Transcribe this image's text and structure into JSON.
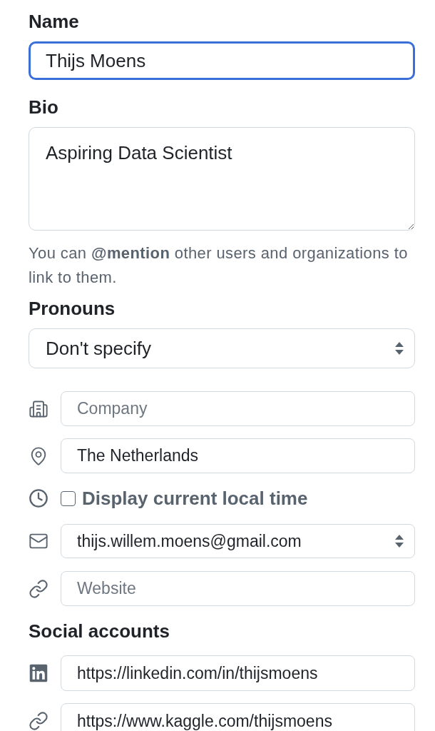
{
  "name": {
    "label": "Name",
    "value": "Thijs Moens",
    "focused": true
  },
  "bio": {
    "label": "Bio",
    "value": "Aspiring Data Scientist",
    "hint": "You can **@mention** other users and organizations to link to them."
  },
  "pronouns": {
    "label": "Pronouns",
    "value": "Don't specify"
  },
  "company": {
    "placeholder": "Company"
  },
  "location": {
    "value": "The Netherlands"
  },
  "local_time": {
    "label": "Display current local time",
    "checked": false
  },
  "email": {
    "value": "thijs.willem.moens@gmail.com"
  },
  "website": {
    "placeholder": "Website"
  },
  "social_accounts": {
    "title": "Social accounts",
    "accounts": [
      {
        "kind": "linkedin",
        "value": "https://linkedin.com/in/thijsmoens"
      },
      {
        "kind": "link",
        "value": "https://www.kaggle.com/thijsmoens"
      }
    ]
  }
}
